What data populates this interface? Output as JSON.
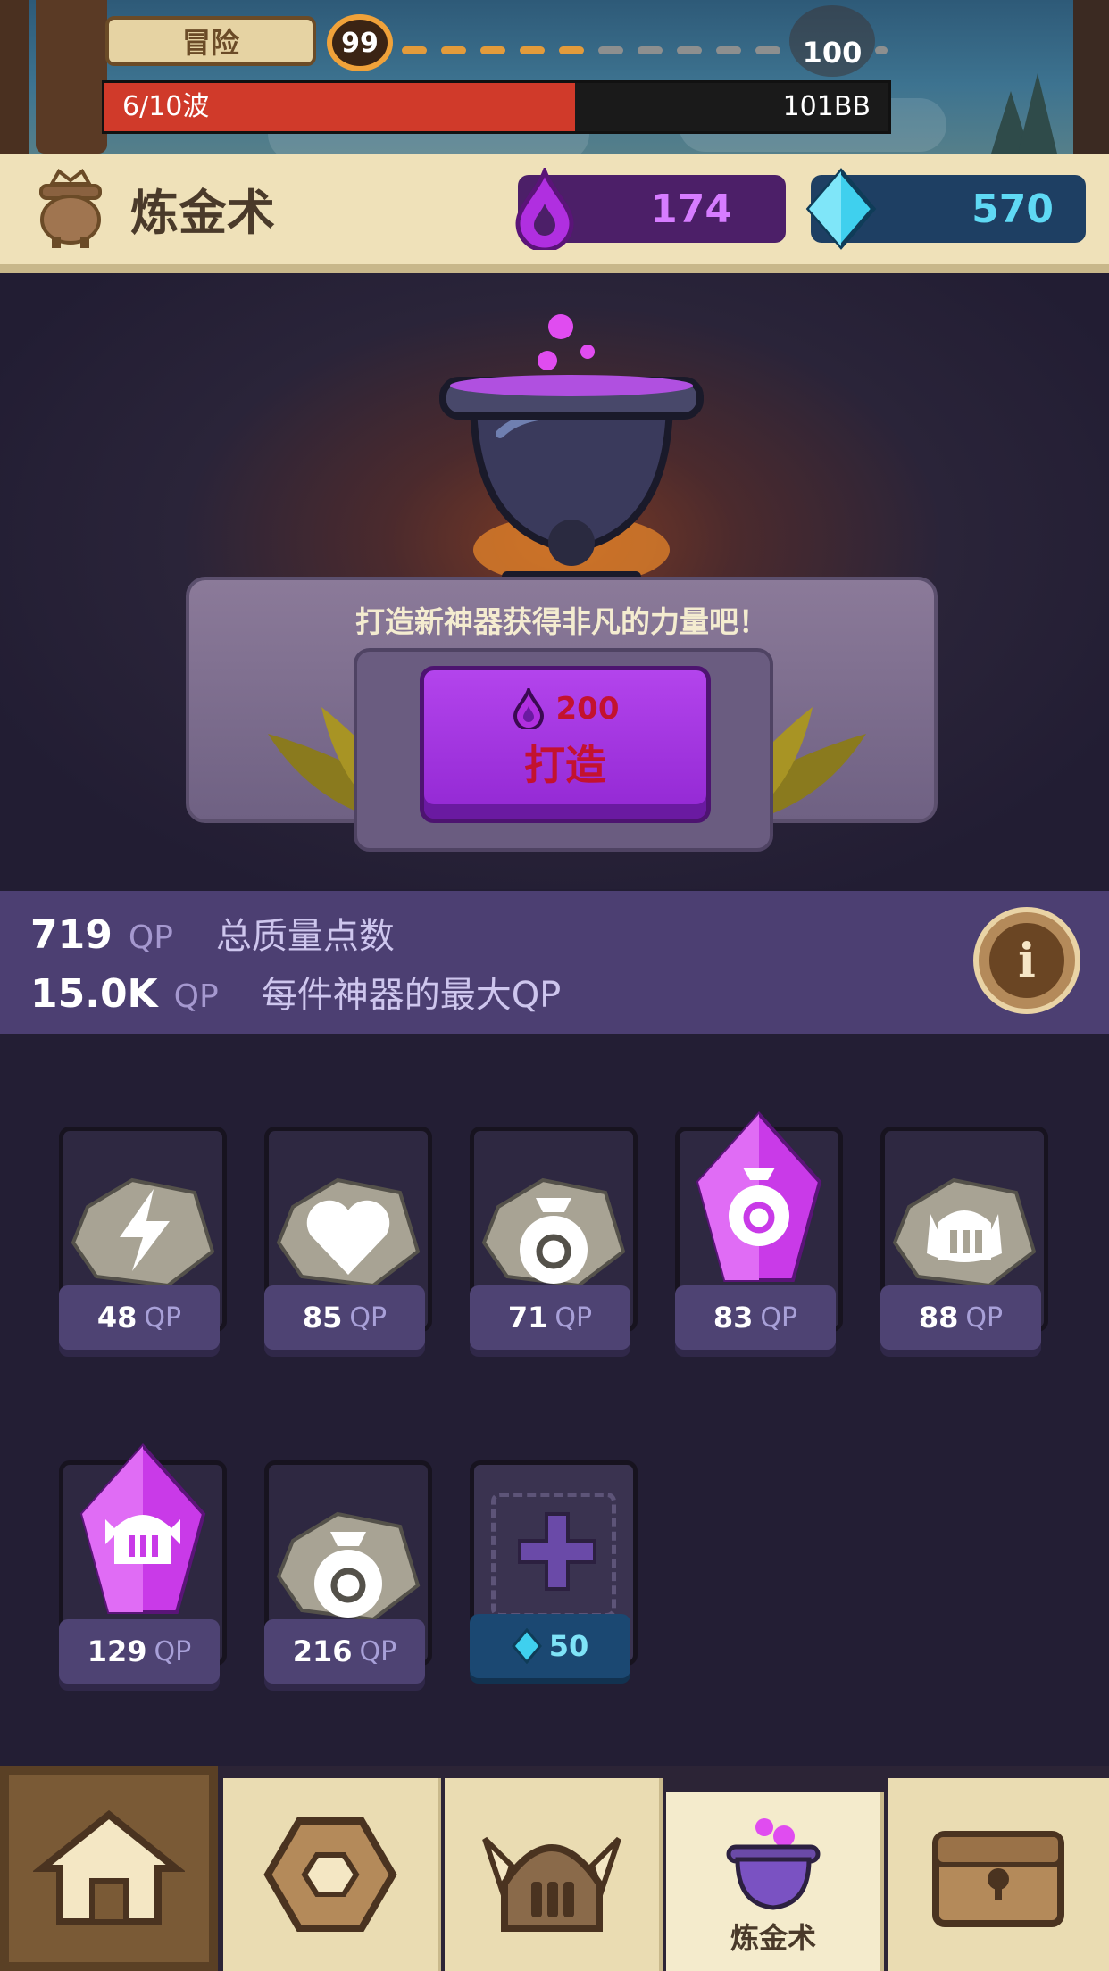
{
  "top": {
    "mode_label": "冒险",
    "current_level": "99",
    "next_level": "100",
    "wave_text": "6/10波",
    "wave_progress": 0.6,
    "currency_right": "101BB"
  },
  "header": {
    "title": "炼金术",
    "elixir": "174",
    "gems": "570"
  },
  "forge": {
    "prompt": "打造新神器获得非凡的力量吧！",
    "cost": "200",
    "button_label": "打造"
  },
  "stats": {
    "total_qp": "719",
    "total_unit": "QP",
    "total_desc": "总质量点数",
    "max_qp": "15.0K",
    "max_unit": "QP",
    "max_desc": "每件神器的最大QP"
  },
  "artifacts": [
    {
      "qp": "48",
      "unit": "QP",
      "icon": "lightning-stone-icon",
      "kind": "stone"
    },
    {
      "qp": "85",
      "unit": "QP",
      "icon": "heart-stone-icon",
      "kind": "stone"
    },
    {
      "qp": "71",
      "unit": "QP",
      "icon": "money-bag-stone-icon",
      "kind": "stone"
    },
    {
      "qp": "83",
      "unit": "QP",
      "icon": "money-bag-crystal-icon",
      "kind": "crystal"
    },
    {
      "qp": "88",
      "unit": "QP",
      "icon": "helmet-stone-icon",
      "kind": "stone"
    },
    {
      "qp": "129",
      "unit": "QP",
      "icon": "helmet-crystal-icon",
      "kind": "crystal"
    },
    {
      "qp": "216",
      "unit": "QP",
      "icon": "money-bag-stone-icon",
      "kind": "stone"
    }
  ],
  "add_slot": {
    "cost": "50"
  },
  "nav": {
    "active_label": "炼金术",
    "tabs": [
      "home-icon",
      "ring-icon",
      "hero-helmet-icon",
      "cauldron-icon",
      "chest-icon"
    ]
  },
  "colors": {
    "elixir": "#c04be8",
    "gem": "#3fd0ee",
    "panel": "#4c3f72",
    "forge_button": "#a73be6"
  }
}
